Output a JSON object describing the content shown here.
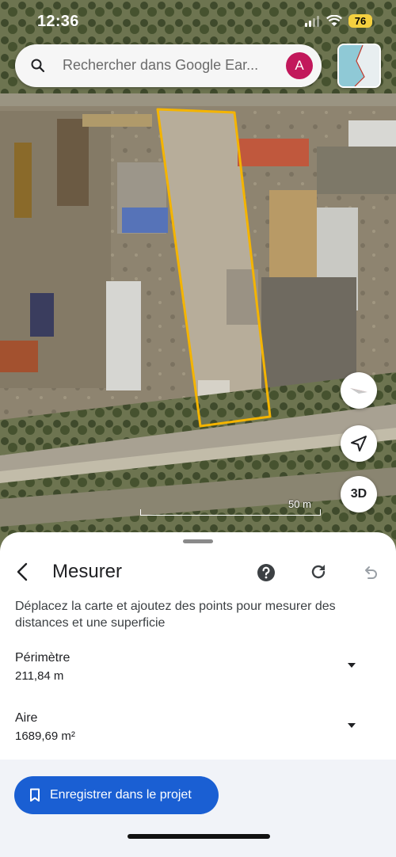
{
  "status_bar": {
    "time": "12:36",
    "battery": "76",
    "icons": [
      "signal-icon",
      "wifi-icon",
      "battery-icon"
    ]
  },
  "search": {
    "placeholder": "Rechercher dans Google Ear...",
    "avatar_letter": "A",
    "icon": "search-icon"
  },
  "map": {
    "scale_label": "50 m",
    "three_d_label": "3D",
    "buttons": [
      "compass-icon",
      "locate-icon",
      "3d-toggle"
    ],
    "measure_outline_color": "#f4b400"
  },
  "sheet": {
    "title": "Mesurer",
    "description": "Déplacez la carte et ajoutez des points pour mesurer des distances et une superficie",
    "perimeter": {
      "label": "Périmètre",
      "value": "211,84 m"
    },
    "area": {
      "label": "Aire",
      "value": "1689,69 m²"
    },
    "save_label": "Enregistrer dans le projet",
    "icons": [
      "back-arrow-icon",
      "help-icon",
      "refresh-icon",
      "undo-icon",
      "dropdown-icon",
      "bookmark-icon"
    ]
  },
  "colors": {
    "accent": "#1a5fd3",
    "avatar": "#c2185b",
    "battery": "#f4d03f"
  }
}
